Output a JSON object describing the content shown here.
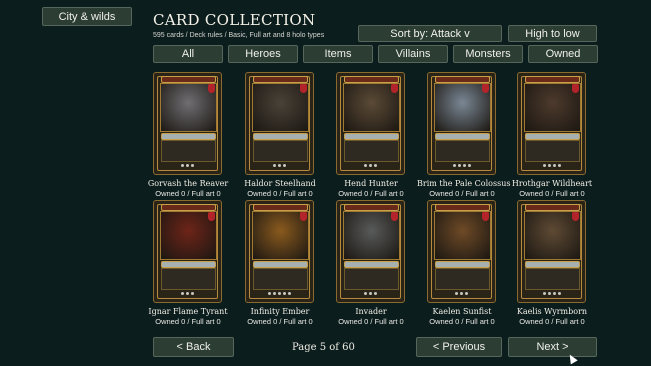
{
  "side_button": "City & wilds",
  "header": {
    "title": "CARD COLLECTION",
    "subtitle": "595 cards / Deck rules / Basic, Full art and 8 holo types",
    "sort_label": "Sort by: Attack v",
    "order_label": "High to low"
  },
  "tabs": [
    "All",
    "Heroes",
    "Items",
    "Villains",
    "Monsters",
    "Owned"
  ],
  "cards": [
    {
      "name": "Gorvash the Reaver",
      "owned": "Owned 0 / Full art 0",
      "art_color": "#6f6e72"
    },
    {
      "name": "Haldor Steelhand",
      "owned": "Owned 0 / Full art 0",
      "art_color": "#4a4238"
    },
    {
      "name": "Hend Hunter",
      "owned": "Owned 0 / Full art 0",
      "art_color": "#5b4a36"
    },
    {
      "name": "Brim the Pale Colossus",
      "owned": "Owned 0 / Full art 0",
      "art_color": "#7a8794"
    },
    {
      "name": "Hrothgar Wildheart",
      "owned": "Owned 0 / Full art 0",
      "art_color": "#4d3a2c"
    },
    {
      "name": "Ignar Flame Tyrant",
      "owned": "Owned 0 / Full art 0",
      "art_color": "#6e2418"
    },
    {
      "name": "Infinity Ember",
      "owned": "Owned 0 / Full art 0",
      "art_color": "#8a5a1e"
    },
    {
      "name": "Invader",
      "owned": "Owned 0 / Full art 0",
      "art_color": "#585a5a"
    },
    {
      "name": "Kaelen Sunfist",
      "owned": "Owned 0 / Full art 0",
      "art_color": "#6e4a26"
    },
    {
      "name": "Kaelis Wyrmborn",
      "owned": "Owned 0 / Full art 0",
      "art_color": "#5e4a34"
    }
  ],
  "footer": {
    "back_label": "< Back",
    "page_label": "Page 5 of 60",
    "prev_label": "< Previous",
    "next_label": "Next >"
  }
}
